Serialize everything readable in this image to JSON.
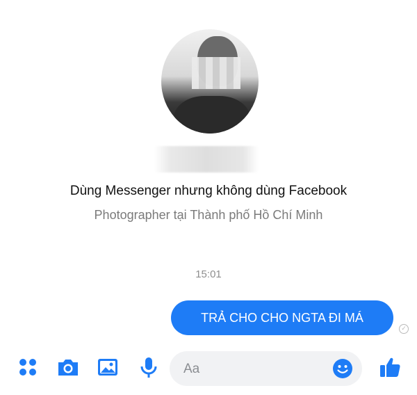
{
  "profile": {
    "bio_line1": "Dùng Messenger nhưng không dùng Facebook",
    "bio_line2": "Photographer tại Thành phố Hồ Chí Minh"
  },
  "conversation": {
    "timestamp": "15:01",
    "messages": [
      {
        "text": "TRẢ CHO CHO NGTA ĐI MÁ",
        "sender": "me",
        "status": "sent"
      }
    ]
  },
  "composer": {
    "placeholder": "Aa"
  },
  "icons": {
    "more": "four-dots-icon",
    "camera": "camera-icon",
    "gallery": "image-icon",
    "voice": "microphone-icon",
    "emoji": "emoji-icon",
    "like": "thumbs-up-icon",
    "seen": "check-circle-icon"
  },
  "colors": {
    "accent": "#1e7cf6",
    "bubble_text": "#ffffff",
    "composer_bg": "#f1f2f4"
  }
}
